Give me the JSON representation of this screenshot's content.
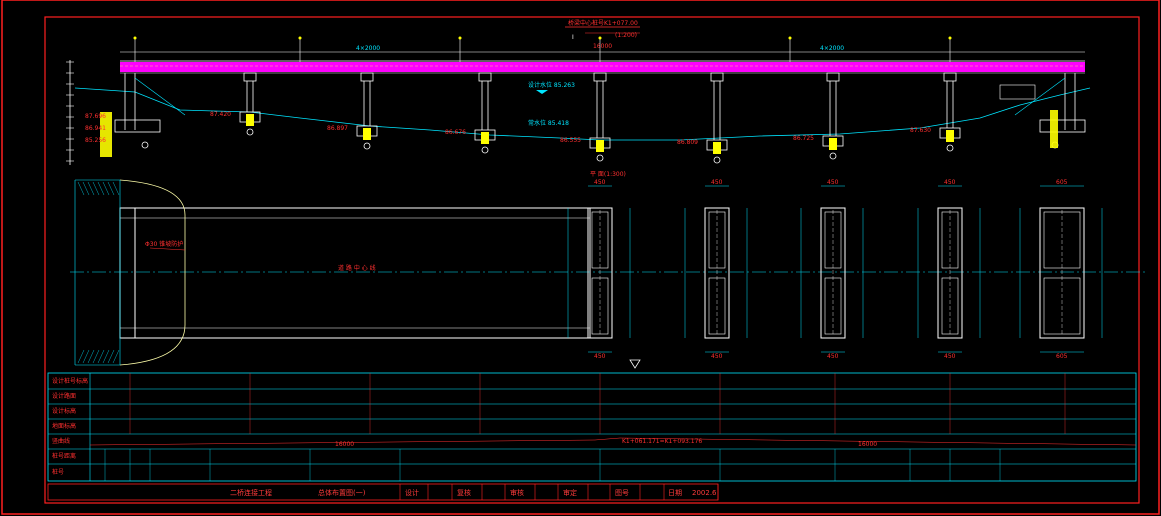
{
  "drawing": {
    "title_elevation": "桥梁中心桩号K1+077.00",
    "section_I": "I",
    "section_scale": "(1:200)",
    "plan_label": "平  面(1:300)",
    "span_left": "4×2000",
    "span_right": "4×2000",
    "center_span": "16000",
    "water_level_1": "设计水位 85.263",
    "water_level_2": "常水位 85.418",
    "elevations_left": [
      "87.696",
      "86.941",
      "85.256"
    ],
    "elevations_piers": [
      "87.420",
      "86.897",
      "86.676",
      "86.555",
      "86.809",
      "86.725",
      "87.630"
    ],
    "plan_note": "Φ30 锥坡防护",
    "road_axis": "道 路 中 心 线",
    "dim_top": [
      "450",
      "450",
      "450",
      "450",
      "605"
    ],
    "dim_bottom": [
      "450",
      "450",
      "450",
      "450",
      "605"
    ],
    "station_main": "K1+061.171=K1+093.176"
  },
  "table": {
    "row_labels": [
      "设计桩号标高",
      "设计路面",
      "设计标高",
      "地面标高",
      "竖曲线",
      "桩号距离",
      "桩号"
    ],
    "bottom_dims": [
      "16000",
      "16000"
    ]
  },
  "title_block": {
    "project": "二桥连接工程",
    "sheet_title": "总体布置图(一)",
    "design": "设计",
    "check": "复核",
    "review": "审核",
    "approve": "审定",
    "drawing_no": "图号",
    "date_label": "日期",
    "date": "2002.6"
  },
  "colors": {
    "frame": "#ff2020",
    "deck": "#ff00ff",
    "lines": "#00e5ff",
    "white": "#ffffff",
    "yellow": "#ffff00"
  }
}
